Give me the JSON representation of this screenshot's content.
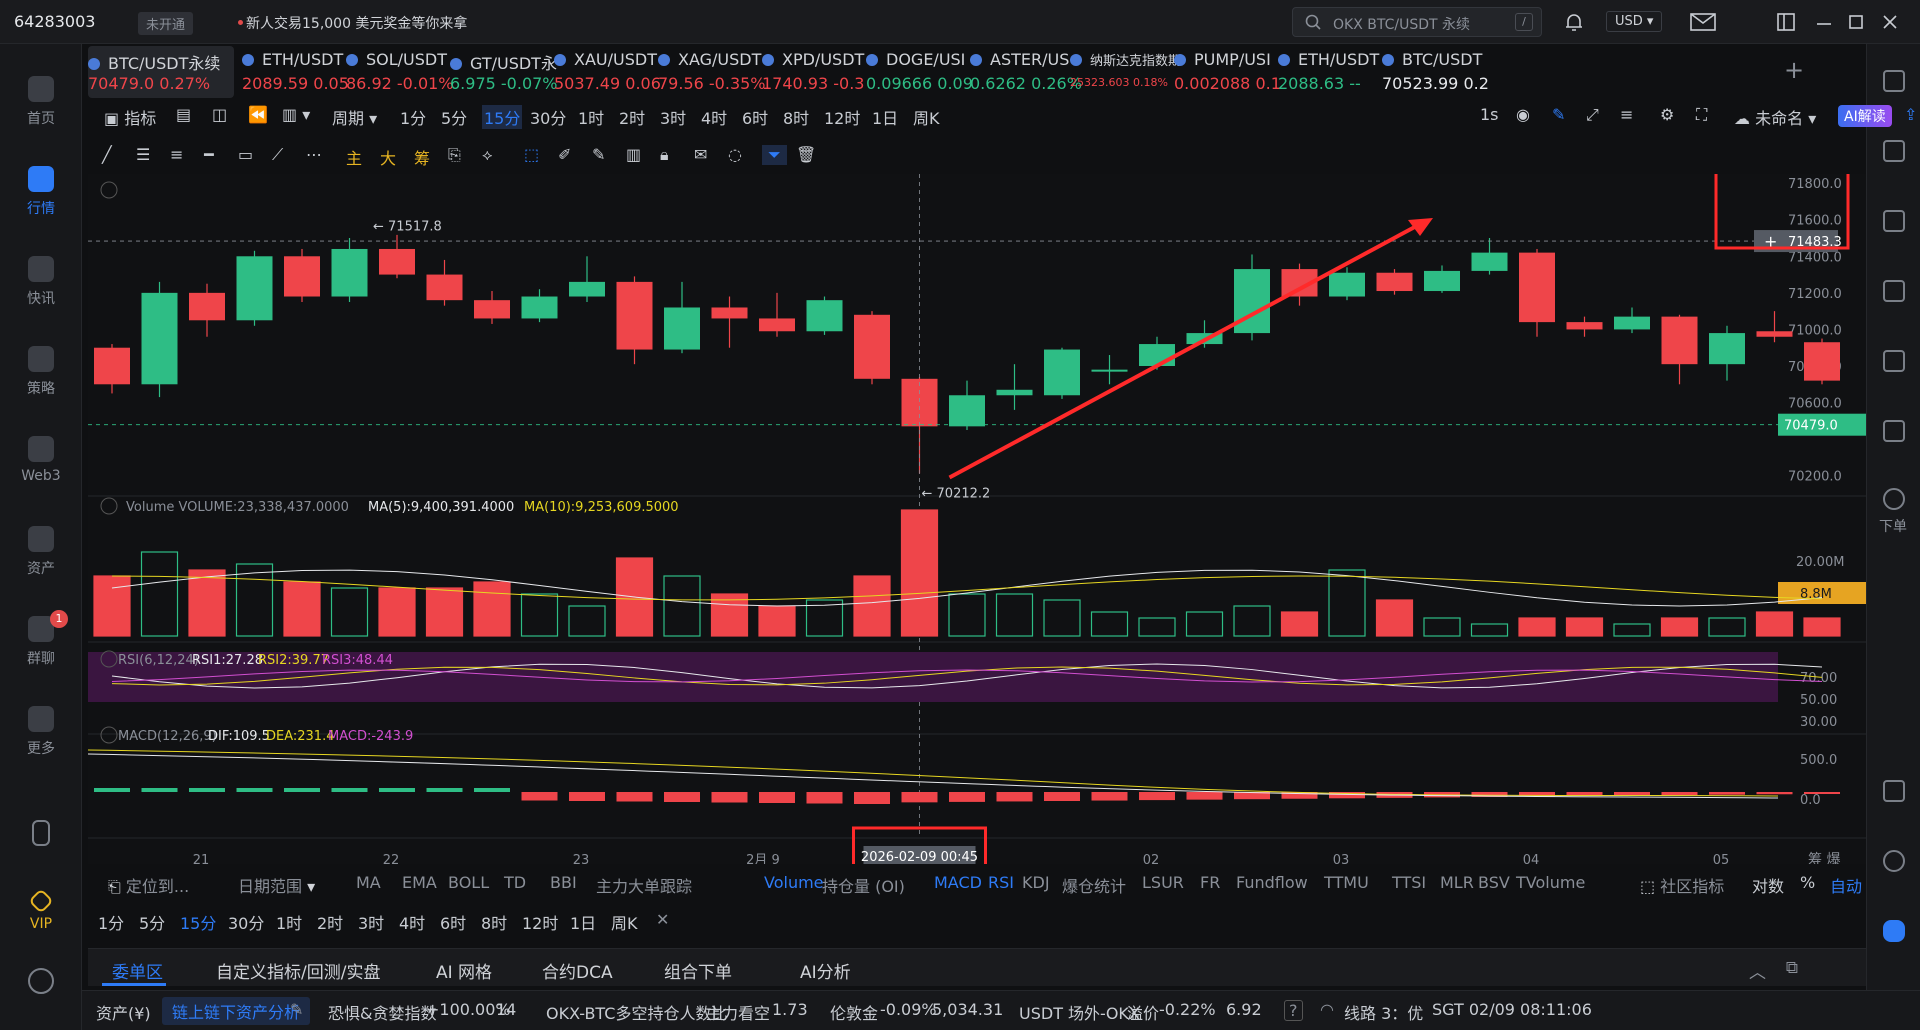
{
  "topbar": {
    "user_id": "64283003",
    "verify_badge": "未开通",
    "promo": "新人交易15,000 美元奖金等你来拿",
    "search_placeholder": "OKX BTC/USDT 永续",
    "search_shortcut": "/",
    "currency": "USD"
  },
  "sidebar": {
    "items": [
      {
        "label": "首页",
        "icon": "home-icon"
      },
      {
        "label": "行情",
        "icon": "market-icon",
        "active": true
      },
      {
        "label": "快讯",
        "icon": "news-icon"
      },
      {
        "label": "策略",
        "icon": "strategy-icon"
      },
      {
        "label": "Web3",
        "icon": "web3-icon"
      },
      {
        "label": "资产",
        "icon": "wallet-icon"
      },
      {
        "label": "群聊",
        "icon": "chat-icon",
        "badge": "1"
      },
      {
        "label": "更多",
        "icon": "more-icon"
      },
      {
        "label": "",
        "icon": "mobile-icon"
      },
      {
        "label": "VIP",
        "icon": "vip-icon"
      },
      {
        "label": "",
        "icon": "settings-icon"
      }
    ]
  },
  "tickers": [
    {
      "name": "BTC/USDT永续",
      "price": "70479.0",
      "change": "0.27%",
      "dir": "dn",
      "active": true
    },
    {
      "name": "ETH/USDT",
      "price": "2089.59",
      "change": "0.05",
      "dir": "dn"
    },
    {
      "name": "SOL/USDT",
      "price": "86.92",
      "change": "-0.01%",
      "dir": "dn"
    },
    {
      "name": "GT/USDT永",
      "price": "6.975",
      "change": "-0.07%",
      "dir": "up"
    },
    {
      "name": "XAU/USDT",
      "price": "5037.49",
      "change": "0.06",
      "dir": "dn"
    },
    {
      "name": "XAG/USDT",
      "price": "79.56",
      "change": "-0.35%",
      "dir": "dn"
    },
    {
      "name": "XPD/USDT",
      "price": "1740.93",
      "change": "-0.3",
      "dir": "dn"
    },
    {
      "name": "DOGE/USI",
      "price": "0.09666",
      "change": "0.09",
      "dir": "up"
    },
    {
      "name": "ASTER/US",
      "price": "0.6262",
      "change": "0.26%",
      "dir": "up"
    },
    {
      "name": "纳斯达克指数期",
      "price": "25323.603",
      "change": "0.18%",
      "dir": "dn"
    },
    {
      "name": "PUMP/USI",
      "price": "0.002088",
      "change": "0.1",
      "dir": "dn"
    },
    {
      "name": "ETH/USDT",
      "price": "2088.63",
      "change": "--",
      "dir": "up"
    },
    {
      "name": "BTC/USDT",
      "price": "70523.99",
      "change": "0.2",
      "dir": "plain"
    }
  ],
  "toolbar": {
    "indicator": "指标",
    "period": "周期",
    "timeframes": [
      "1分",
      "5分",
      "15分",
      "30分",
      "1时",
      "2时",
      "3时",
      "4时",
      "6时",
      "8时",
      "12时",
      "1日",
      "周K"
    ],
    "selected_tf": "15分",
    "refresh": "1s",
    "layout_name": "未命名",
    "ai_button": "AI解读"
  },
  "draw_tools": {
    "main": "主",
    "big": "大",
    "chip": "筹"
  },
  "chart": {
    "price_labels": [
      "71800.0",
      "71600.0",
      "71400.0",
      "71200.0",
      "71000.0",
      "70800.0",
      "70600.0",
      "70200.0"
    ],
    "crosshair_price": "71483.3",
    "last_price": "70479.0",
    "high_marker": "← 71517.8",
    "low_marker": "← 70212.2",
    "volume_legend": "Volume  VOLUME:23,338,437.0000",
    "vol_ma5": "MA(5):9,400,391.4000",
    "vol_ma10": "MA(10):9,253,609.5000",
    "vol_axis": "20.00M",
    "vol_current": "8.8M",
    "rsi_legend": "RSI(6,12,24)",
    "rsi1": "RSI1:27.28",
    "rsi2": "RSI2:39.77",
    "rsi3": "RSI3:48.44",
    "rsi_axis": [
      "70.00",
      "50.00",
      "30.00"
    ],
    "macd_legend": "MACD(12,26,9)",
    "dif": "DIF:109.5",
    "dea": "DEA:231.4",
    "macd": "MACD:-243.9",
    "macd_axis": [
      "500.0",
      "0.0"
    ],
    "x_labels": [
      "21",
      "22",
      "23",
      "2月 9",
      "02",
      "03",
      "04",
      "05"
    ],
    "crosshair_time": "2026-02-09 00:45",
    "corner_labels": "筹  爆",
    "colors": {
      "up": "#2ebd85",
      "down": "#ef454a",
      "accent": "#2e7bf6",
      "highlight": "#ff2a2a"
    }
  },
  "chart_data": {
    "type": "candlestick",
    "symbol": "BTC/USDT永续",
    "interval": "15分",
    "ylim": [
      70100,
      71850
    ],
    "candles": [
      {
        "o": 70900,
        "c": 70700,
        "h": 70920,
        "l": 70650
      },
      {
        "o": 70700,
        "c": 71200,
        "h": 71260,
        "l": 70630
      },
      {
        "o": 71200,
        "c": 71050,
        "h": 71250,
        "l": 70960
      },
      {
        "o": 71050,
        "c": 71400,
        "h": 71430,
        "l": 71020
      },
      {
        "o": 71400,
        "c": 71180,
        "h": 71440,
        "l": 71150
      },
      {
        "o": 71180,
        "c": 71440,
        "h": 71500,
        "l": 71150
      },
      {
        "o": 71440,
        "c": 71300,
        "h": 71517,
        "l": 71280
      },
      {
        "o": 71300,
        "c": 71160,
        "h": 71380,
        "l": 71130
      },
      {
        "o": 71160,
        "c": 71060,
        "h": 71210,
        "l": 71030
      },
      {
        "o": 71060,
        "c": 71180,
        "h": 71220,
        "l": 71040
      },
      {
        "o": 71180,
        "c": 71260,
        "h": 71400,
        "l": 71150
      },
      {
        "o": 71260,
        "c": 70890,
        "h": 71290,
        "l": 70810
      },
      {
        "o": 70890,
        "c": 71120,
        "h": 71260,
        "l": 70870
      },
      {
        "o": 71120,
        "c": 71060,
        "h": 71180,
        "l": 70900
      },
      {
        "o": 71060,
        "c": 70990,
        "h": 71200,
        "l": 70960
      },
      {
        "o": 70990,
        "c": 71160,
        "h": 71180,
        "l": 70970
      },
      {
        "o": 71080,
        "c": 70730,
        "h": 71100,
        "l": 70700
      },
      {
        "o": 70730,
        "c": 70470,
        "h": 70740,
        "l": 70212
      },
      {
        "o": 70470,
        "c": 70640,
        "h": 70720,
        "l": 70450
      },
      {
        "o": 70640,
        "c": 70670,
        "h": 70810,
        "l": 70560
      },
      {
        "o": 70640,
        "c": 70890,
        "h": 70900,
        "l": 70620
      },
      {
        "o": 70780,
        "c": 70780,
        "h": 70860,
        "l": 70700
      },
      {
        "o": 70800,
        "c": 70920,
        "h": 70960,
        "l": 70780
      },
      {
        "o": 70920,
        "c": 70980,
        "h": 71050,
        "l": 70900
      },
      {
        "o": 70980,
        "c": 71330,
        "h": 71410,
        "l": 70940
      },
      {
        "o": 71330,
        "c": 71180,
        "h": 71360,
        "l": 71130
      },
      {
        "o": 71180,
        "c": 71310,
        "h": 71340,
        "l": 71160
      },
      {
        "o": 71310,
        "c": 71210,
        "h": 71330,
        "l": 71190
      },
      {
        "o": 71210,
        "c": 71320,
        "h": 71350,
        "l": 71200
      },
      {
        "o": 71320,
        "c": 71420,
        "h": 71500,
        "l": 71300
      },
      {
        "o": 71420,
        "c": 71040,
        "h": 71440,
        "l": 70960
      },
      {
        "o": 71040,
        "c": 71000,
        "h": 71070,
        "l": 70960
      },
      {
        "o": 71000,
        "c": 71070,
        "h": 71120,
        "l": 70980
      },
      {
        "o": 71070,
        "c": 70810,
        "h": 71080,
        "l": 70700
      },
      {
        "o": 70810,
        "c": 70980,
        "h": 71020,
        "l": 70720
      },
      {
        "o": 70990,
        "c": 70960,
        "h": 71100,
        "l": 70930
      },
      {
        "o": 70930,
        "c": 70720,
        "h": 70950,
        "l": 70700
      }
    ],
    "volume": [
      10,
      14,
      11,
      12,
      9,
      8,
      8,
      8,
      9,
      7,
      5,
      13,
      10,
      7,
      5,
      6,
      10,
      21,
      7,
      7,
      6,
      4,
      3,
      4,
      5,
      4,
      11,
      6,
      3,
      2,
      3,
      3,
      2,
      3,
      3,
      4,
      3,
      3
    ]
  },
  "indicator_row": {
    "locate": "定位到...",
    "date_range": "日期范围",
    "items": [
      "MA",
      "EMA",
      "BOLL",
      "TD",
      "BBI",
      "主力大单跟踪"
    ],
    "subs": [
      "Volume",
      "持仓量 (OI)",
      "MACD",
      "RSI",
      "KDJ",
      "爆仓统计",
      "LSUR",
      "FR",
      "Fundflow",
      "TTMU",
      "TTSI",
      "MLR",
      "BSV",
      "TVolume"
    ],
    "community": "社区指标",
    "log": "对数",
    "pct": "%",
    "auto": "自动"
  },
  "bottom_tabs": [
    "委单区",
    "自定义指标/回测/实盘",
    "AI 网格",
    "合约DCA",
    "组合下单",
    "AI分析"
  ],
  "statusbar": {
    "assets": "资产(¥)",
    "chain_analysis": "链上链下资产分析",
    "fear_greed_label": "恐惧&贪婪指数",
    "fear_greed_change": "+100.00%",
    "fear_greed_value": "14",
    "ls_label": "OKX-BTC多空持仓人数比",
    "ls_tag": "主力看空",
    "ls_value": "1.73",
    "gold_label": "伦敦金",
    "gold_change": "-0.09%",
    "gold_value": "5,034.31",
    "otc_label": "USDT 场外-OKX",
    "otc_tag": "溢价",
    "otc_change": "-0.22%",
    "otc_value": "6.92",
    "line": "线路 3：优",
    "time": "SGT 02/09 08:11:06"
  }
}
